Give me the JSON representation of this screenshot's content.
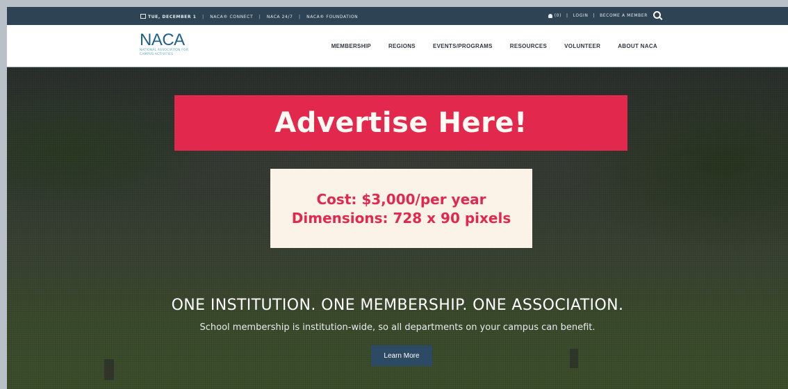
{
  "utility_bar": {
    "date": "TUE, DECEMBER 1",
    "links": [
      "NACA® CONNECT",
      "NACA 24/7",
      "NACA® FOUNDATION"
    ],
    "notifications": "(0)",
    "login": "LOGIN",
    "become_member": "BECOME A MEMBER",
    "icons": [
      "calendar-icon",
      "bell-icon",
      "search-icon"
    ]
  },
  "header": {
    "logo_text": "NACA",
    "logo_tagline": "NATIONAL ASSOCIATION FOR CAMPUS ACTIVITIES",
    "nav": [
      "MEMBERSHIP",
      "REGIONS",
      "EVENTS/PROGRAMS",
      "RESOURCES",
      "VOLUNTEER",
      "ABOUT NACA"
    ]
  },
  "ad": {
    "banner_text": "Advertise Here!",
    "cost": "Cost: $3,000/per year",
    "dimensions": "Dimensions: 728 x 90 pixels"
  },
  "hero": {
    "title": "ONE INSTITUTION. ONE MEMBERSHIP. ONE ASSOCIATION.",
    "subtitle": "School membership is institution-wide, so all departments on your campus can benefit.",
    "button": "Learn More"
  },
  "colors": {
    "utility_bar_bg": "#2e4454",
    "ad_red": "#e3284d",
    "ad_info_bg": "#fbf3e8",
    "button_bg": "#2c4a63",
    "logo_blue": "#1f5f8b"
  }
}
